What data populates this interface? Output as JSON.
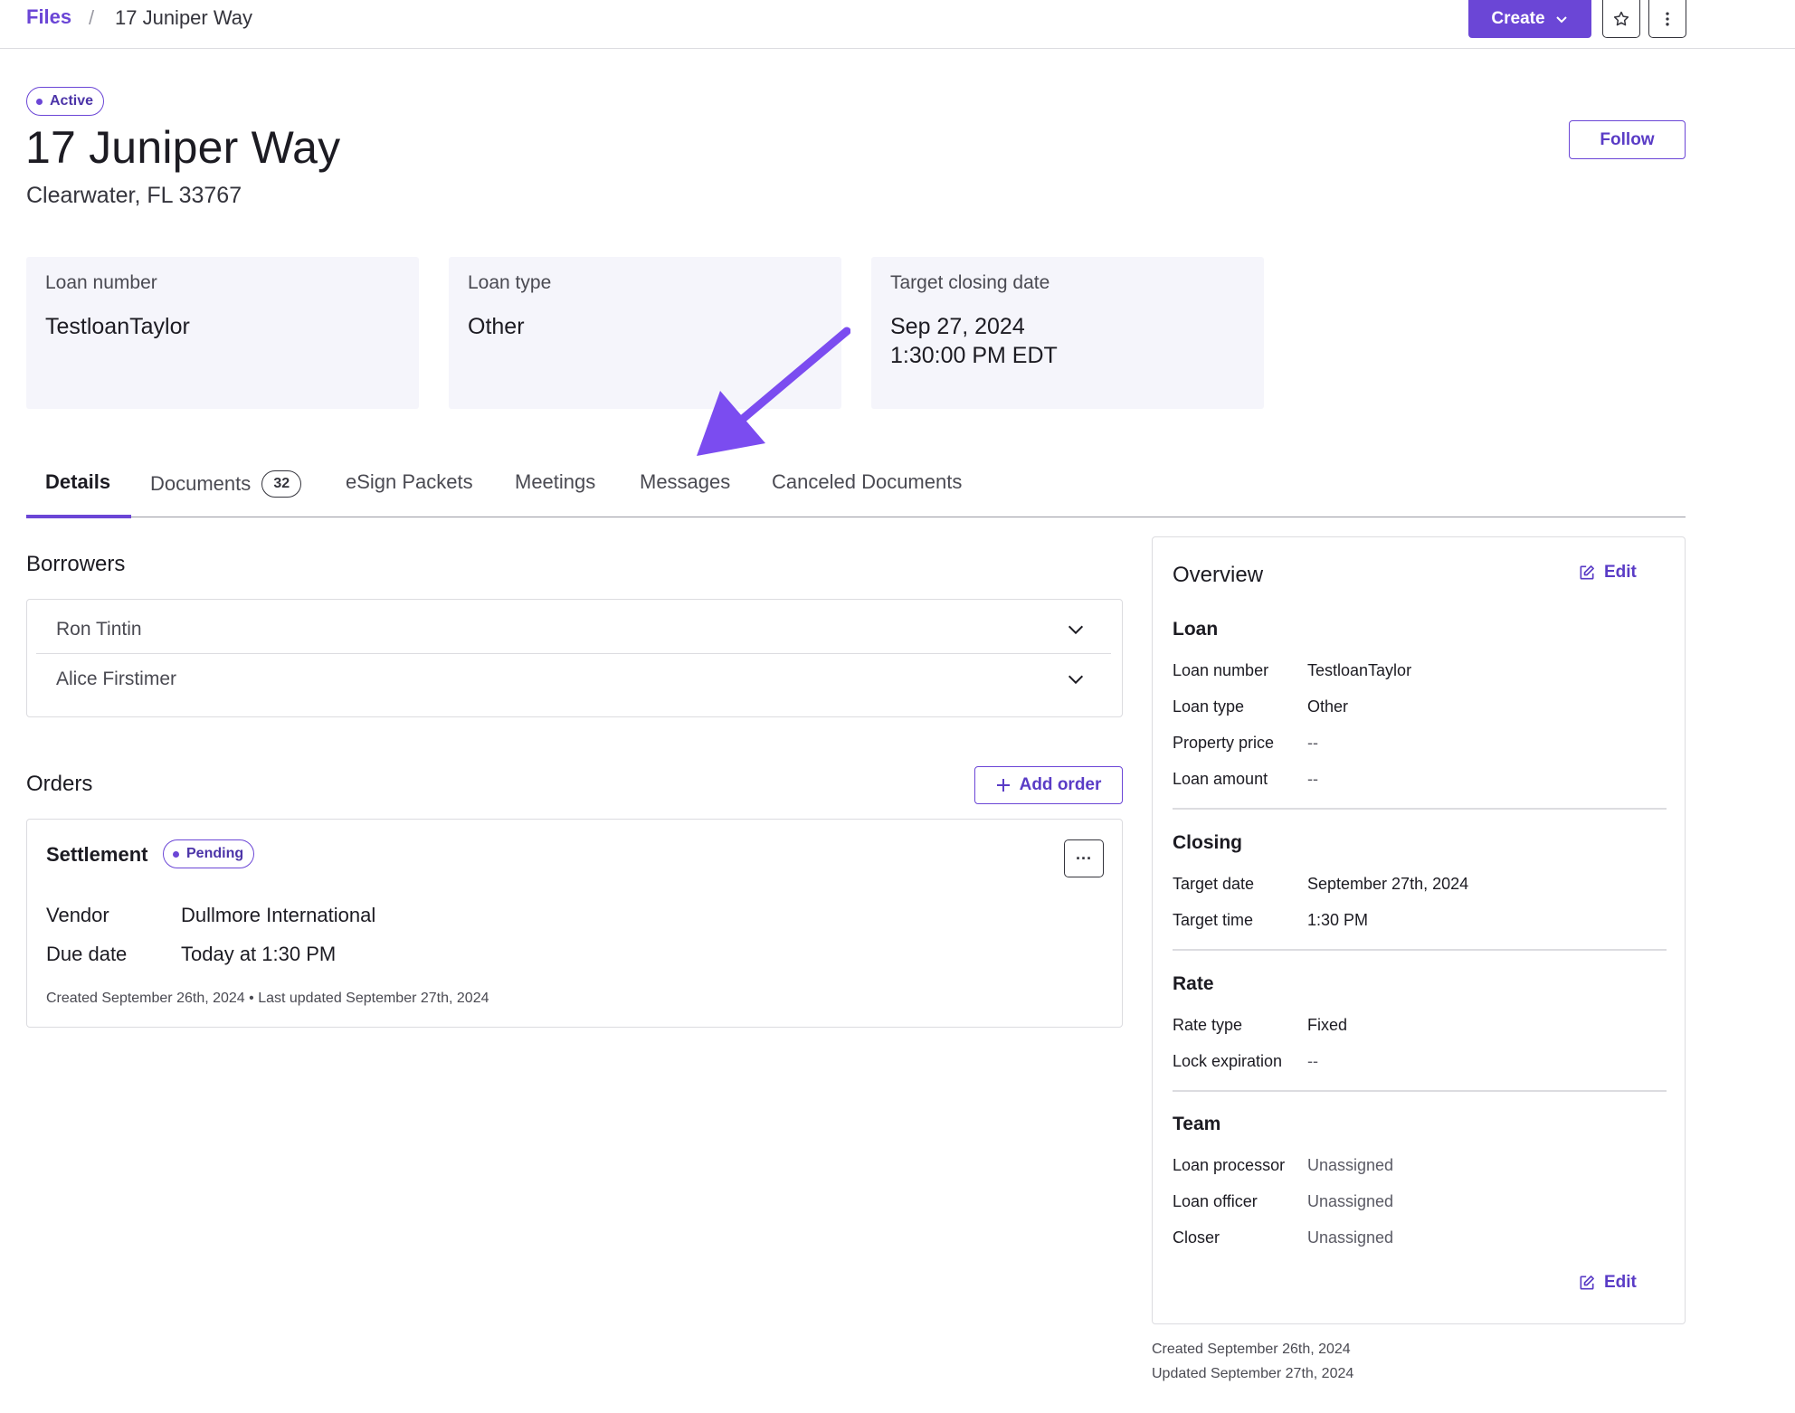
{
  "breadcrumb": {
    "root": "Files",
    "separator": "/",
    "current": "17 Juniper Way"
  },
  "toolbar": {
    "create_label": "Create",
    "star_icon": "star-icon",
    "more_icon": "more-vertical-icon"
  },
  "header": {
    "status": "Active",
    "title": "17 Juniper Way",
    "subtitle": "Clearwater, FL 33767",
    "follow_label": "Follow"
  },
  "summary": {
    "loan_number": {
      "label": "Loan number",
      "value": "TestloanTaylor"
    },
    "loan_type": {
      "label": "Loan type",
      "value": "Other"
    },
    "closing": {
      "label": "Target closing date",
      "date": "Sep 27, 2024",
      "time": "1:30:00 PM EDT"
    }
  },
  "tabs": [
    {
      "label": "Details",
      "active": true
    },
    {
      "label": "Documents",
      "badge": "32"
    },
    {
      "label": "eSign Packets"
    },
    {
      "label": "Meetings"
    },
    {
      "label": "Messages"
    },
    {
      "label": "Canceled Documents"
    }
  ],
  "borrowers": {
    "heading": "Borrowers",
    "items": [
      "Ron Tintin",
      "Alice Firstimer"
    ]
  },
  "orders": {
    "heading": "Orders",
    "add_label": "Add order",
    "order": {
      "title": "Settlement",
      "status": "Pending",
      "more_label": "···",
      "vendor_label": "Vendor",
      "vendor": "Dullmore International",
      "due_label": "Due date",
      "due": "Today at 1:30 PM",
      "meta": "Created September 26th, 2024 • Last updated September 27th, 2024"
    }
  },
  "overview": {
    "title": "Overview",
    "edit_label": "Edit",
    "loan": {
      "heading": "Loan",
      "rows": [
        {
          "k": "Loan number",
          "v": "TestloanTaylor"
        },
        {
          "k": "Loan type",
          "v": "Other"
        },
        {
          "k": "Property price",
          "v": "--"
        },
        {
          "k": "Loan amount",
          "v": "--"
        }
      ]
    },
    "closing": {
      "heading": "Closing",
      "rows": [
        {
          "k": "Target date",
          "v": "September 27th, 2024"
        },
        {
          "k": "Target time",
          "v": "1:30 PM"
        }
      ]
    },
    "rate": {
      "heading": "Rate",
      "rows": [
        {
          "k": "Rate type",
          "v": "Fixed"
        },
        {
          "k": "Lock expiration",
          "v": "--"
        }
      ]
    },
    "team": {
      "heading": "Team",
      "rows": [
        {
          "k": "Loan processor",
          "v": "Unassigned"
        },
        {
          "k": "Loan officer",
          "v": "Unassigned"
        },
        {
          "k": "Closer",
          "v": "Unassigned"
        }
      ]
    },
    "created": "Created September 26th, 2024",
    "updated": "Updated September 27th, 2024"
  },
  "colors": {
    "accent": "#6b46d6",
    "annotation_arrow": "#7b4cf0"
  }
}
